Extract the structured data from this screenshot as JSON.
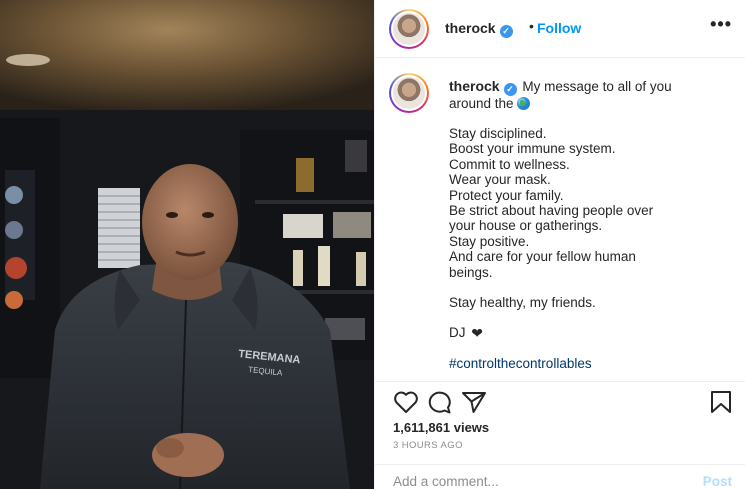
{
  "post": {
    "username": "therock",
    "verified_icon": "verified-check-icon",
    "follow_separator": "•",
    "follow_label": "Follow",
    "more_label": "•••",
    "caption": {
      "username": "therock",
      "intro_before_emoji": "My message to all of you",
      "intro_line2": "around the",
      "emoji": "earth-globe-icon",
      "lines": [
        "Stay disciplined.",
        "Boost your immune system.",
        "Commit to wellness.",
        "Wear your mask.",
        "Protect your family.",
        "Be strict about having people over",
        "your house or gatherings.",
        "Stay positive.",
        "And care for your fellow human",
        "beings."
      ],
      "closing": "Stay healthy, my friends.",
      "signoff": "DJ",
      "signoff_heart": "❤",
      "hashtag": "#controlthecontrollables"
    },
    "views": "1,611,861 views",
    "time": "3 HOURS AGO",
    "comment_placeholder": "Add a comment...",
    "post_label": "Post"
  },
  "colors": {
    "link_blue": "#0095f6",
    "hashtag": "#00376b",
    "post_disabled": "#b2dffc",
    "muted": "#8e8e8e"
  }
}
